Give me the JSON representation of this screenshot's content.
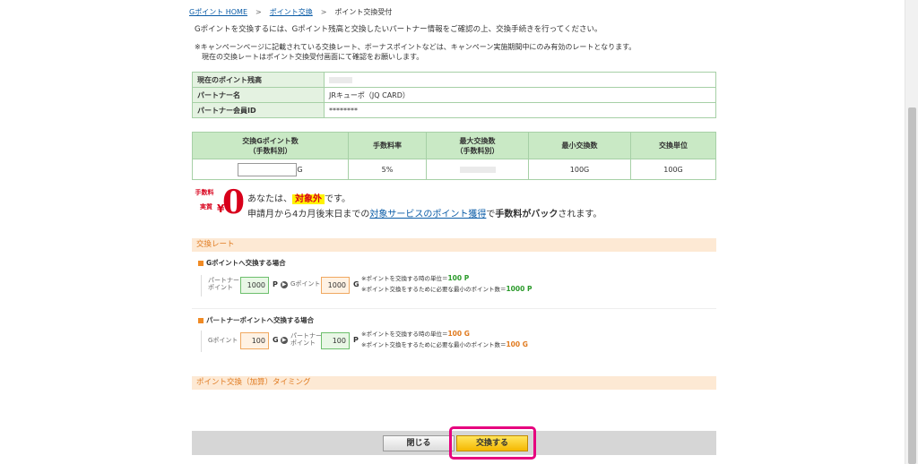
{
  "breadcrumb": {
    "home": "Gポイント HOME",
    "exchange": "ポイント交換",
    "current": "ポイント交換受付"
  },
  "intro": "Gポイントを交換するには、Gポイント残高と交換したいパートナー情報をご確認の上、交換手続きを行ってください。",
  "note": {
    "line1": "※キャンペーンページに記載されている交換レート、ボーナスポイントなどは、キャンペーン実施期間中にのみ有効のレートとなります。",
    "line2": "現在の交換レートはポイント交換受付画面にて確認をお願いします。"
  },
  "info": {
    "balance_label": "現在のポイント残高",
    "partner_label": "パートナー名",
    "partner_value": "JRキューポ（JQ CARD）",
    "member_label": "パートナー会員ID",
    "member_value": "********"
  },
  "exchange_table": {
    "col1_line1": "交換Gポイント数",
    "col1_line2": "（手数料別）",
    "col2": "手数料率",
    "col3_line1": "最大交換数",
    "col3_line2": "（手数料別）",
    "col4": "最小交換数",
    "col5": "交換単位",
    "input_unit": "G",
    "fee_rate": "5%",
    "min_exchange": "100G",
    "exchange_unit": "100G"
  },
  "fee": {
    "badge_top": "手数料",
    "badge_bottom": "実質",
    "badge_yen": "¥",
    "badge_zero": "0",
    "line1_prefix": "あなたは、",
    "line1_highlight": "対象外",
    "line1_suffix": "です。",
    "line2_prefix": "申請月から4カ月後末日までの",
    "line2_link": "対象サービスのポイント獲得",
    "line2_middle": "で",
    "line2_bold": "手数料がバック",
    "line2_suffix": "されます。"
  },
  "rate": {
    "section_title": "交換レート",
    "to_g": {
      "title": "Gポイントへ交換する場合",
      "partner_label_1": "パートナー",
      "partner_label_2": "ポイント",
      "partner_value": "1000",
      "partner_unit": "P",
      "g_label": "Gポイント",
      "g_value": "1000",
      "g_unit": "G",
      "note1_prefix": "※ポイントを交換する時の単位＝",
      "note1_value": "100 P",
      "note2_prefix": "※ポイント交換をするために必要な最小のポイント数＝",
      "note2_value": "1000 P"
    },
    "to_partner": {
      "title": "パートナーポイントへ交換する場合",
      "g_label": "Gポイント",
      "g_value": "100",
      "g_unit": "G",
      "partner_label_1": "パートナー",
      "partner_label_2": "ポイント",
      "partner_value": "100",
      "partner_unit": "P",
      "note1_prefix": "※ポイントを交換する時の単位＝",
      "note1_value": "100 G",
      "note2_prefix": "※ポイント交換をするために必要な最小のポイント数＝",
      "note2_value": "100 G"
    }
  },
  "timing": {
    "section_title": "ポイント交換（加算）タイミング"
  },
  "buttons": {
    "close": "閉じる",
    "exchange": "交換する"
  },
  "colors": {
    "accent_orange": "#e07a1f",
    "highlight_pink": "#e6007e",
    "table_green": "#c9e9c5"
  }
}
